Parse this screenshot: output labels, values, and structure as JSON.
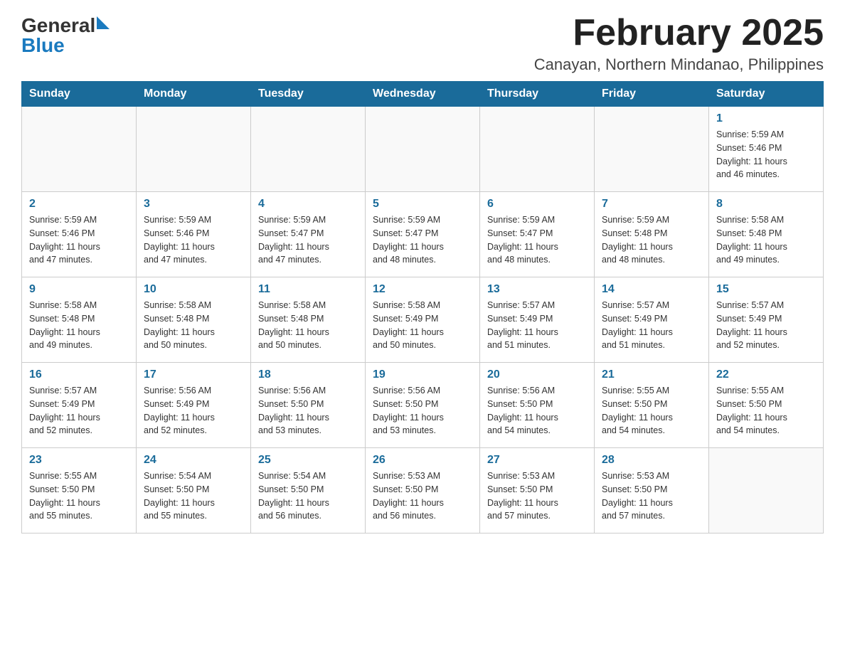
{
  "header": {
    "logo_general": "General",
    "logo_blue": "Blue",
    "month_year": "February 2025",
    "location": "Canayan, Northern Mindanao, Philippines"
  },
  "days_of_week": [
    "Sunday",
    "Monday",
    "Tuesday",
    "Wednesday",
    "Thursday",
    "Friday",
    "Saturday"
  ],
  "weeks": [
    {
      "days": [
        {
          "number": "",
          "info": ""
        },
        {
          "number": "",
          "info": ""
        },
        {
          "number": "",
          "info": ""
        },
        {
          "number": "",
          "info": ""
        },
        {
          "number": "",
          "info": ""
        },
        {
          "number": "",
          "info": ""
        },
        {
          "number": "1",
          "info": "Sunrise: 5:59 AM\nSunset: 5:46 PM\nDaylight: 11 hours\nand 46 minutes."
        }
      ]
    },
    {
      "days": [
        {
          "number": "2",
          "info": "Sunrise: 5:59 AM\nSunset: 5:46 PM\nDaylight: 11 hours\nand 47 minutes."
        },
        {
          "number": "3",
          "info": "Sunrise: 5:59 AM\nSunset: 5:46 PM\nDaylight: 11 hours\nand 47 minutes."
        },
        {
          "number": "4",
          "info": "Sunrise: 5:59 AM\nSunset: 5:47 PM\nDaylight: 11 hours\nand 47 minutes."
        },
        {
          "number": "5",
          "info": "Sunrise: 5:59 AM\nSunset: 5:47 PM\nDaylight: 11 hours\nand 48 minutes."
        },
        {
          "number": "6",
          "info": "Sunrise: 5:59 AM\nSunset: 5:47 PM\nDaylight: 11 hours\nand 48 minutes."
        },
        {
          "number": "7",
          "info": "Sunrise: 5:59 AM\nSunset: 5:48 PM\nDaylight: 11 hours\nand 48 minutes."
        },
        {
          "number": "8",
          "info": "Sunrise: 5:58 AM\nSunset: 5:48 PM\nDaylight: 11 hours\nand 49 minutes."
        }
      ]
    },
    {
      "days": [
        {
          "number": "9",
          "info": "Sunrise: 5:58 AM\nSunset: 5:48 PM\nDaylight: 11 hours\nand 49 minutes."
        },
        {
          "number": "10",
          "info": "Sunrise: 5:58 AM\nSunset: 5:48 PM\nDaylight: 11 hours\nand 50 minutes."
        },
        {
          "number": "11",
          "info": "Sunrise: 5:58 AM\nSunset: 5:48 PM\nDaylight: 11 hours\nand 50 minutes."
        },
        {
          "number": "12",
          "info": "Sunrise: 5:58 AM\nSunset: 5:49 PM\nDaylight: 11 hours\nand 50 minutes."
        },
        {
          "number": "13",
          "info": "Sunrise: 5:57 AM\nSunset: 5:49 PM\nDaylight: 11 hours\nand 51 minutes."
        },
        {
          "number": "14",
          "info": "Sunrise: 5:57 AM\nSunset: 5:49 PM\nDaylight: 11 hours\nand 51 minutes."
        },
        {
          "number": "15",
          "info": "Sunrise: 5:57 AM\nSunset: 5:49 PM\nDaylight: 11 hours\nand 52 minutes."
        }
      ]
    },
    {
      "days": [
        {
          "number": "16",
          "info": "Sunrise: 5:57 AM\nSunset: 5:49 PM\nDaylight: 11 hours\nand 52 minutes."
        },
        {
          "number": "17",
          "info": "Sunrise: 5:56 AM\nSunset: 5:49 PM\nDaylight: 11 hours\nand 52 minutes."
        },
        {
          "number": "18",
          "info": "Sunrise: 5:56 AM\nSunset: 5:50 PM\nDaylight: 11 hours\nand 53 minutes."
        },
        {
          "number": "19",
          "info": "Sunrise: 5:56 AM\nSunset: 5:50 PM\nDaylight: 11 hours\nand 53 minutes."
        },
        {
          "number": "20",
          "info": "Sunrise: 5:56 AM\nSunset: 5:50 PM\nDaylight: 11 hours\nand 54 minutes."
        },
        {
          "number": "21",
          "info": "Sunrise: 5:55 AM\nSunset: 5:50 PM\nDaylight: 11 hours\nand 54 minutes."
        },
        {
          "number": "22",
          "info": "Sunrise: 5:55 AM\nSunset: 5:50 PM\nDaylight: 11 hours\nand 54 minutes."
        }
      ]
    },
    {
      "days": [
        {
          "number": "23",
          "info": "Sunrise: 5:55 AM\nSunset: 5:50 PM\nDaylight: 11 hours\nand 55 minutes."
        },
        {
          "number": "24",
          "info": "Sunrise: 5:54 AM\nSunset: 5:50 PM\nDaylight: 11 hours\nand 55 minutes."
        },
        {
          "number": "25",
          "info": "Sunrise: 5:54 AM\nSunset: 5:50 PM\nDaylight: 11 hours\nand 56 minutes."
        },
        {
          "number": "26",
          "info": "Sunrise: 5:53 AM\nSunset: 5:50 PM\nDaylight: 11 hours\nand 56 minutes."
        },
        {
          "number": "27",
          "info": "Sunrise: 5:53 AM\nSunset: 5:50 PM\nDaylight: 11 hours\nand 57 minutes."
        },
        {
          "number": "28",
          "info": "Sunrise: 5:53 AM\nSunset: 5:50 PM\nDaylight: 11 hours\nand 57 minutes."
        },
        {
          "number": "",
          "info": ""
        }
      ]
    }
  ]
}
